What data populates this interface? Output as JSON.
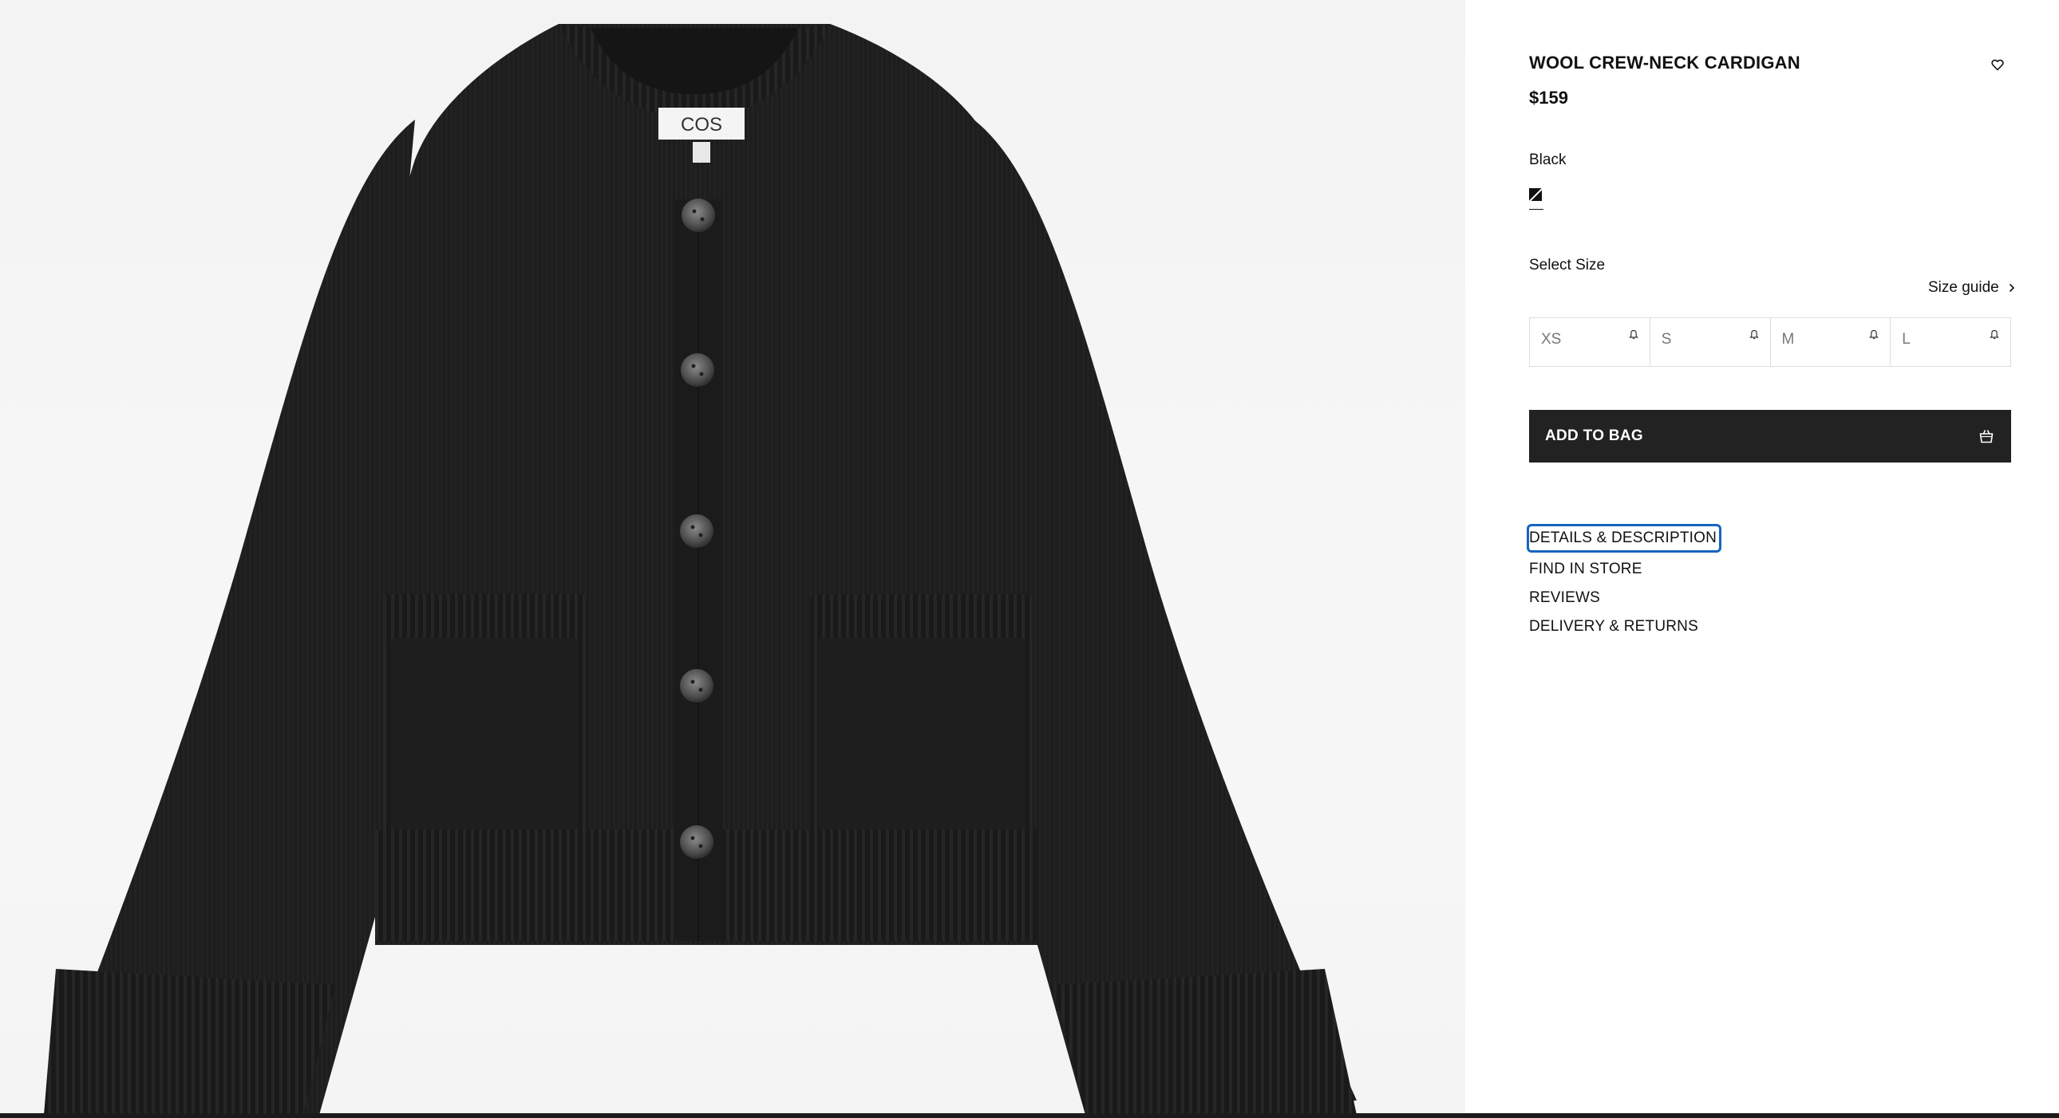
{
  "product": {
    "image_alt": "Black wool crew-neck cardigan with five buttons and two patch pockets",
    "label_brand": "COS",
    "title": "WOOL CREW-NECK CARDIGAN",
    "price": "$159",
    "wishlist_icon": "heart-icon"
  },
  "color": {
    "selected_name": "Black",
    "swatch_color": "#111111"
  },
  "sizes": {
    "label": "Select Size",
    "guide_label": "Size guide",
    "guide_icon": "chevron-right-icon",
    "options": [
      {
        "label": "XS",
        "icon": "bell-icon"
      },
      {
        "label": "S",
        "icon": "bell-icon"
      },
      {
        "label": "M",
        "icon": "bell-icon"
      },
      {
        "label": "L",
        "icon": "bell-icon"
      }
    ]
  },
  "cart": {
    "add_label": "ADD TO BAG",
    "icon": "shopping-bag-icon",
    "button_color": "#222222"
  },
  "accordion": {
    "items": [
      {
        "label": "DETAILS & DESCRIPTION"
      },
      {
        "label": "FIND IN STORE"
      },
      {
        "label": "REVIEWS"
      },
      {
        "label": "DELIVERY & RETURNS"
      }
    ],
    "focus_color": "#1565c0"
  }
}
